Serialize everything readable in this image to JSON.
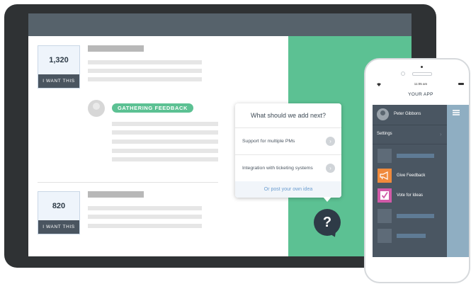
{
  "tablet": {
    "items": [
      {
        "votes": "1,320",
        "button_label": "I WANT THIS"
      },
      {
        "votes": "820",
        "button_label": "I WANT THIS"
      }
    ],
    "status_badge": "GATHERING FEEDBACK"
  },
  "popup": {
    "title": "What should we add next?",
    "options": [
      {
        "label": "Support for multiple PMs"
      },
      {
        "label": "Integration with ticketing systems"
      }
    ],
    "link": "Or post your own idea",
    "help_icon": "?"
  },
  "phone": {
    "status_time": "11:05 am",
    "app_title": "YOUR APP",
    "user_name": "Peter Gibbons",
    "settings_label": "Settings",
    "menu_items": [
      {
        "label": "Give Feedback",
        "icon": "megaphone-icon"
      },
      {
        "label": "Vote for Ideas",
        "icon": "checkbox-icon"
      }
    ]
  },
  "colors": {
    "accent_green": "#5cc193",
    "dark_slate": "#2e3b47",
    "orange": "#f08a3c",
    "pink": "#d15aa8"
  }
}
